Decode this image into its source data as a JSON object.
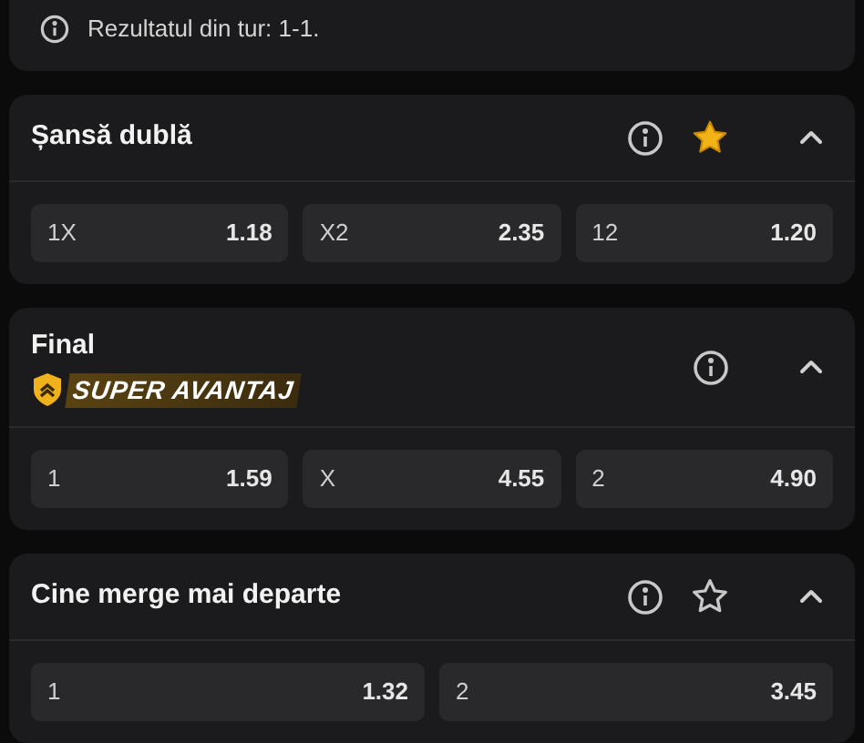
{
  "notice": {
    "text": "Rezultatul din tur: 1-1."
  },
  "markets": [
    {
      "title": "Șansă dublă",
      "favorite": true,
      "outcomes": [
        {
          "label": "1X",
          "odds": "1.18"
        },
        {
          "label": "X2",
          "odds": "2.35"
        },
        {
          "label": "12",
          "odds": "1.20"
        }
      ]
    },
    {
      "title": "Final",
      "badge": "SUPER AVANTAJ",
      "outcomes": [
        {
          "label": "1",
          "odds": "1.59"
        },
        {
          "label": "X",
          "odds": "4.55"
        },
        {
          "label": "2",
          "odds": "4.90"
        }
      ]
    },
    {
      "title": "Cine merge mai departe",
      "favorite": false,
      "outcomes": [
        {
          "label": "1",
          "odds": "1.32"
        },
        {
          "label": "2",
          "odds": "3.45"
        }
      ]
    }
  ]
}
